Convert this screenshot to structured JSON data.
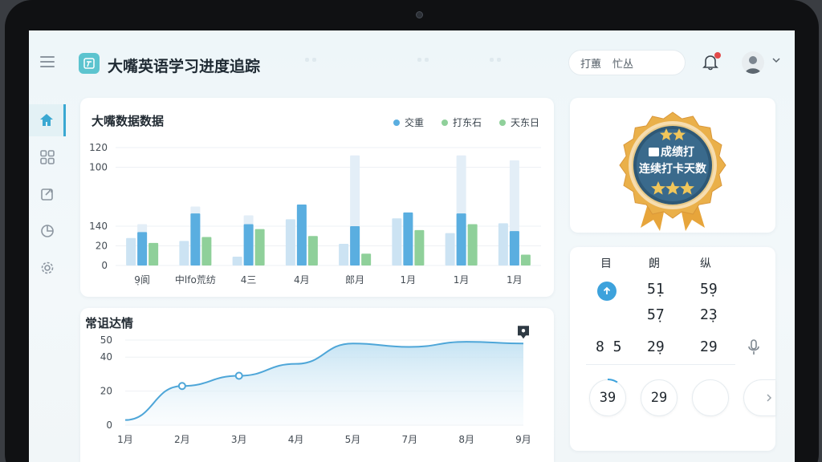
{
  "app": {
    "title": "大嘴英语学习进度追踪"
  },
  "search": {
    "text_1": "打蕙",
    "text_2": "忙丛"
  },
  "bar_card": {
    "title": "大嘴数据数据",
    "legend": [
      {
        "label": "交重",
        "color": "#5aaee0"
      },
      {
        "label": "打东石",
        "color": "#8fd09a"
      },
      {
        "label": "天东日",
        "color": "#8fd09a"
      }
    ]
  },
  "line_card": {
    "title": "常诅达情"
  },
  "badge": {
    "line1": "成绩打",
    "line2": "连续打卡天数"
  },
  "stats": {
    "headers": [
      "目",
      "朗",
      "纵"
    ],
    "row1": [
      "5̣1",
      "5̣9"
    ],
    "row2": [
      "5̣7",
      "2̣3"
    ],
    "row3": [
      "8 5",
      "2̣9",
      "29"
    ],
    "circles": [
      "39",
      "29",
      "",
      ""
    ]
  },
  "chart_data": [
    {
      "type": "bar",
      "categories": [
        "9̣阆",
        "中lfo荒纺",
        "4三",
        "4月",
        "郎月",
        "1月",
        "1月",
        "1月"
      ],
      "ylim": [
        0,
        120
      ],
      "yticks": [
        "0",
        "20",
        "140",
        "100",
        "120"
      ],
      "series": [
        {
          "color": "#cce3f3",
          "values": [
            28,
            25,
            9,
            47,
            22,
            48,
            33,
            43
          ]
        },
        {
          "color": "#5aaee0",
          "values": [
            34,
            53,
            42,
            62,
            40,
            54,
            53,
            35
          ]
        },
        {
          "color": "#8fd09a",
          "values": [
            23,
            29,
            37,
            30,
            12,
            36,
            42,
            11
          ]
        }
      ],
      "backdrop": [
        42,
        60,
        51,
        55,
        112,
        52,
        112,
        107
      ]
    },
    {
      "type": "area",
      "x": [
        "1月",
        "2月",
        "3月",
        "4月",
        "5月",
        "7月",
        "8月",
        "9月"
      ],
      "ylim": [
        0,
        50
      ],
      "yticks": [
        "0",
        "20",
        "40",
        "50"
      ],
      "values": [
        3,
        23,
        29,
        36,
        48,
        46,
        49,
        48
      ],
      "markers": [
        1,
        2
      ]
    }
  ]
}
